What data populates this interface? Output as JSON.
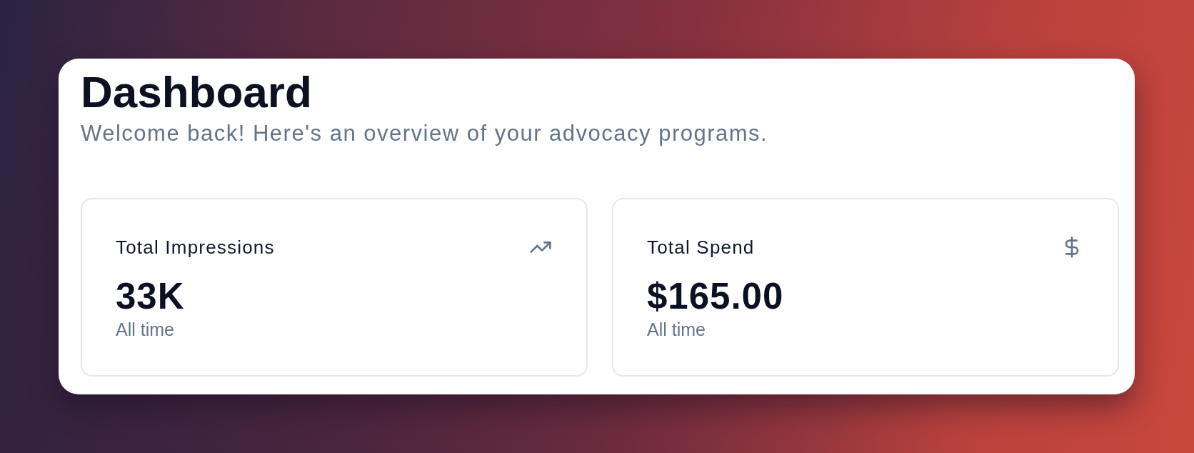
{
  "header": {
    "title": "Dashboard",
    "subtitle": "Welcome back! Here's an overview of your advocacy programs."
  },
  "stats": [
    {
      "kind": "trend",
      "label": "Total Impressions",
      "value": "33K",
      "caption": "All time"
    },
    {
      "kind": "dollar",
      "label": "Total Spend",
      "value": "$165.00",
      "caption": "All time"
    }
  ]
}
